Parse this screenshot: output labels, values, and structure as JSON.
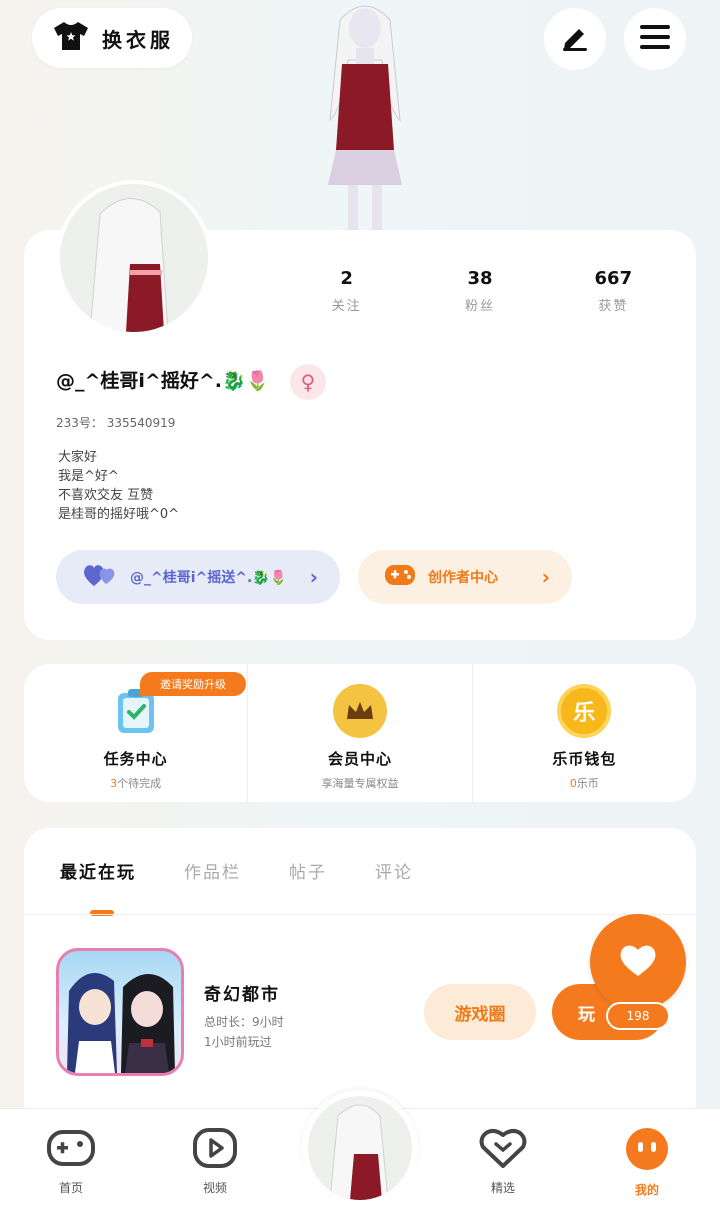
{
  "top": {
    "change_outfit_label": "换衣服",
    "edit_icon": "pencil-icon",
    "menu_icon": "hamburger-menu-icon"
  },
  "profile": {
    "stats": [
      {
        "value": "2",
        "label": "关注"
      },
      {
        "value": "38",
        "label": "粉丝"
      },
      {
        "value": "667",
        "label": "获赞"
      }
    ],
    "username": "@_^桂哥i^摇好^.🐉🌷",
    "gender_symbol": "♀",
    "uid": "233号： 335540919",
    "bio": "大家好\n我是^好^\n不喜欢交友 互赞\n是桂哥的摇好哦^0^",
    "fan_pill_label": "@_^桂哥i^摇送^.🐉🌷",
    "creator_pill_label": "创作者中心"
  },
  "services": {
    "task_badge": "邀请奖励升级",
    "items": [
      {
        "title": "任务中心",
        "sub_highlight": "3",
        "sub": "个待完成"
      },
      {
        "title": "会员中心",
        "sub_highlight": "",
        "sub": "享海量专属权益"
      },
      {
        "title": "乐币钱包",
        "sub_highlight": "0",
        "sub": "乐币"
      }
    ],
    "wallet_coin_char": "乐"
  },
  "activity": {
    "tabs": [
      "最近在玩",
      "作品栏",
      "帖子",
      "评论"
    ],
    "game": {
      "name": "奇幻都市",
      "total_time": "总时长：9小时",
      "last_played": "1小时前玩过",
      "circle_button": "游戏圈",
      "play_button": "玩"
    },
    "like_count": "198"
  },
  "nav": {
    "items": [
      "首页",
      "视频",
      "精选",
      "我的"
    ]
  }
}
